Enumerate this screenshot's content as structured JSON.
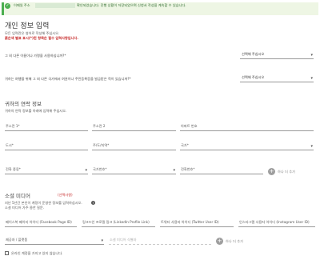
{
  "banner": {
    "prefix": "이메일 주소",
    "message": "확인되었습니다. 진행 상황이 저장되었으며 신청서 작성을 계속할 수 있습니다."
  },
  "personal": {
    "title": "개인 정보 입력",
    "intro": "모든 입력란은 영어로 작성해 주십시오.",
    "required_note": "붉은색 별표 표시(*)된 항목은 필수 입력사항입니다.",
    "q1": "그 외 다른 이름이나 가명을 사용하십니까?*",
    "q1_select": "선택해 주십시오",
    "q2": "귀하는 여행을 위해 그 외 다른 국가에서 여권이나 주민등록증을 발급받은 적이 있습니까?*",
    "q2_select": "선택해 주십시오"
  },
  "contact": {
    "title": "귀하의 연락 정보",
    "intro": "귀하의 연락 정보를 아래에 입력해 주십시오.",
    "address1": "주소란 1*",
    "address2": "주소란 2",
    "apt": "아파트 번호",
    "city": "도시*",
    "state": "주/도/지역*",
    "country": "국가*",
    "phone_type": "전화 종류*",
    "country_code": "국가번호*",
    "phone_number": "전화번호*",
    "add_more": "하나 더 추가"
  },
  "social": {
    "title": "소셜 미디어",
    "optional": "(선택사항)",
    "intro1": "지난 5년간 본인이 계정이 운영한 정보를 입력하십시오.",
    "intro2": "소셜 미디어 가주 웅찬 질문.",
    "facebook": "페이스북 페이지 아이디 (Facebook Page ID)",
    "linkedin": "링크드인 프로필 링크 (LinkedIn Profile Link)",
    "twitter": "트위터 사용자 아이디 (Twitter User ID)",
    "instagram": "인스타그램 사용자 아이디 (Instagram User ID)",
    "platform": "제공자 / 플랫폼",
    "identifier": "소셜 미디어 식별자",
    "add_more": "하나 더 추가",
    "no_accounts": "온라인 계정을 가지고 있지 않습니다."
  }
}
